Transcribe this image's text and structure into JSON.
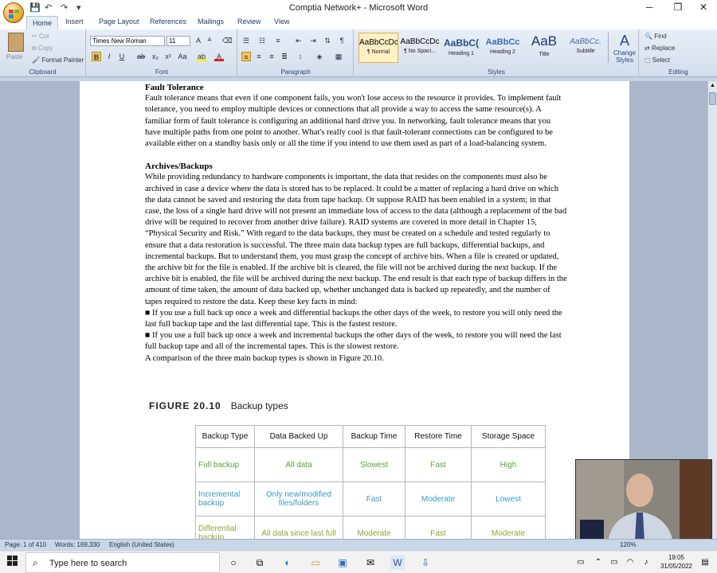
{
  "window": {
    "title": "Comptia Network+ - Microsoft Word"
  },
  "qat": {
    "save": "💾",
    "undo": "↶",
    "redo": "↷",
    "customize": "▾"
  },
  "tabs": [
    "Home",
    "Insert",
    "Page Layout",
    "References",
    "Mailings",
    "Review",
    "View"
  ],
  "ribbon": {
    "clipboard": {
      "paste": "Paste",
      "cut": "Cut",
      "copy": "Copy",
      "format_painter": "Format Painter",
      "group": "Clipboard"
    },
    "font": {
      "name": "Times New Roman",
      "size": "11",
      "group": "Font"
    },
    "paragraph": {
      "group": "Paragraph"
    },
    "styles": {
      "group": "Styles",
      "items": [
        {
          "preview": "AaBbCcDc",
          "name": "¶ Normal"
        },
        {
          "preview": "AaBbCcDc",
          "name": "¶ No Spaci..."
        },
        {
          "preview": "AaBbC(",
          "name": "Heading 1"
        },
        {
          "preview": "AaBbCc",
          "name": "Heading 2"
        },
        {
          "preview": "AaB",
          "name": "Title"
        },
        {
          "preview": "AaBbCc.",
          "name": "Subtitle"
        }
      ],
      "change_styles": "Change Styles"
    },
    "editing": {
      "find": "Find",
      "replace": "Replace",
      "select": "Select",
      "group": "Editing"
    }
  },
  "document": {
    "heading1": "Fault Tolerance",
    "para1": "Fault tolerance means that even if one component fails, you won't lose access to the resource it provides. To implement fault tolerance, you need to employ multiple devices or connections that all provide a way to access the same resource(s). A familiar form of fault tolerance is configuring an additional hard drive you. In networking, fault tolerance means that you have multiple paths from one point to another. What's really cool is that fault-tolerant connections can be configured to be available either on a standby basis only or all the time if you intend to use them used as part of a load-balancing system.",
    "heading2": "Archives/Backups",
    "para2": "While providing redundancy to hardware components is important, the data that resides on the components must also be archived in case a device where the data is stored has to be replaced. It could be a matter of replacing a hard drive on which the data cannot be saved and restoring the data from tape backup. Or suppose RAID has been enabled in a system; in that case, the loss of a single hard drive will not present an immediate loss of access to the data (although a replacement of the bad drive will be required to recover from another drive failure). RAID systems are covered in more detail in Chapter 15, “Physical Security and Risk.” With regard to the data backups, they must be created on a schedule and tested regularly to ensure that a data restoration is successful. The three main data backup types are full backups, differential backups, and incremental backups. But to understand them, you must grasp the concept of archive bits. When a file is created or updated, the archive bit for the file is enabled. If the archive bit is cleared, the file will not be archived during the next backup. If the archive bit is enabled, the file will be archived during the next backup. The end result is that each type of backup differs in the amount of time taken, the amount of data backed up, whether unchanged data is backed up repeatedly, and the number of tapes required to restore the data. Keep these key facts in mind:",
    "bullet1": "■ If you use a full back up once a week and differential backups the other days of the week, to restore you will only need the last full backup tape and the last differential tape. This is the fastest restore.",
    "bullet2": "■ If you use a full back up once a week and incremental backups the other days of the week, to restore you will need the last full backup tape and all of the incremental tapes. This is the slowest restore.",
    "para3": "A comparison of the three main backup types is shown in Figure 20.10.",
    "figure_label": "FIGURE 20.10",
    "figure_title": "Backup types",
    "table": {
      "headers": [
        "Backup Type",
        "Data Backed Up",
        "Backup Time",
        "Restore Time",
        "Storage Space"
      ],
      "rows": [
        [
          "Full backup",
          "All data",
          "Slowest",
          "Fast",
          "High"
        ],
        [
          "Incremental backup",
          "Only new/modified files/folders",
          "Fast",
          "Moderate",
          "Lowest"
        ],
        [
          "Differential backup",
          "All data since last full",
          "Moderate",
          "Fast",
          "Moderate"
        ]
      ]
    }
  },
  "status": {
    "page": "Page: 1 of 410",
    "words": "Words: 169,330",
    "language": "English (United States)",
    "zoom": "120%"
  },
  "taskbar": {
    "search_placeholder": "Type here to search",
    "time": "19:05",
    "date": "31/05/2022"
  },
  "colors": {
    "full": "#5aa331",
    "incremental": "#3b98c4",
    "differential": "#8aa832"
  }
}
